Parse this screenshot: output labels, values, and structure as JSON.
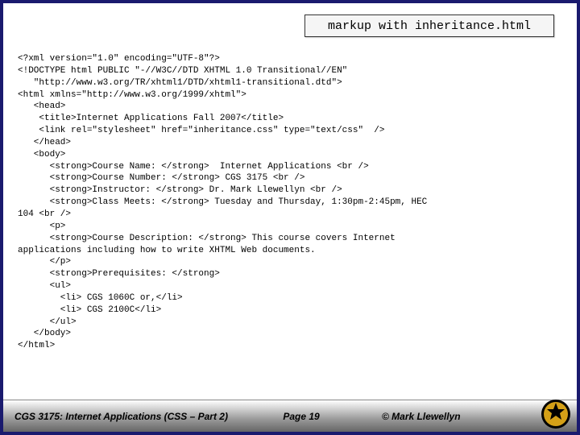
{
  "title": "markup with inheritance.html",
  "code": "<?xml version=\"1.0\" encoding=\"UTF-8\"?>\n<!DOCTYPE html PUBLIC \"-//W3C//DTD XHTML 1.0 Transitional//EN\"\n   \"http://www.w3.org/TR/xhtml1/DTD/xhtml1-transitional.dtd\">\n<html xmlns=\"http://www.w3.org/1999/xhtml\">\n   <head>\n    <title>Internet Applications Fall 2007</title>\n    <link rel=\"stylesheet\" href=\"inheritance.css\" type=\"text/css\"  />\n   </head>\n   <body>\n      <strong>Course Name: </strong>  Internet Applications <br />\n      <strong>Course Number: </strong> CGS 3175 <br />\n      <strong>Instructor: </strong> Dr. Mark Llewellyn <br />\n      <strong>Class Meets: </strong> Tuesday and Thursday, 1:30pm-2:45pm, HEC\n104 <br />\n      <p>\n      <strong>Course Description: </strong> This course covers Internet\napplications including how to write XHTML Web documents.\n      </p>\n      <strong>Prerequisites: </strong>\n      <ul>\n        <li> CGS 1060C or,</li>\n        <li> CGS 2100C</li>\n      </ul>\n   </body>\n</html>",
  "footer": {
    "left": "CGS 3175: Internet Applications (CSS – Part 2)",
    "center": "Page 19",
    "right": "© Mark Llewellyn"
  }
}
